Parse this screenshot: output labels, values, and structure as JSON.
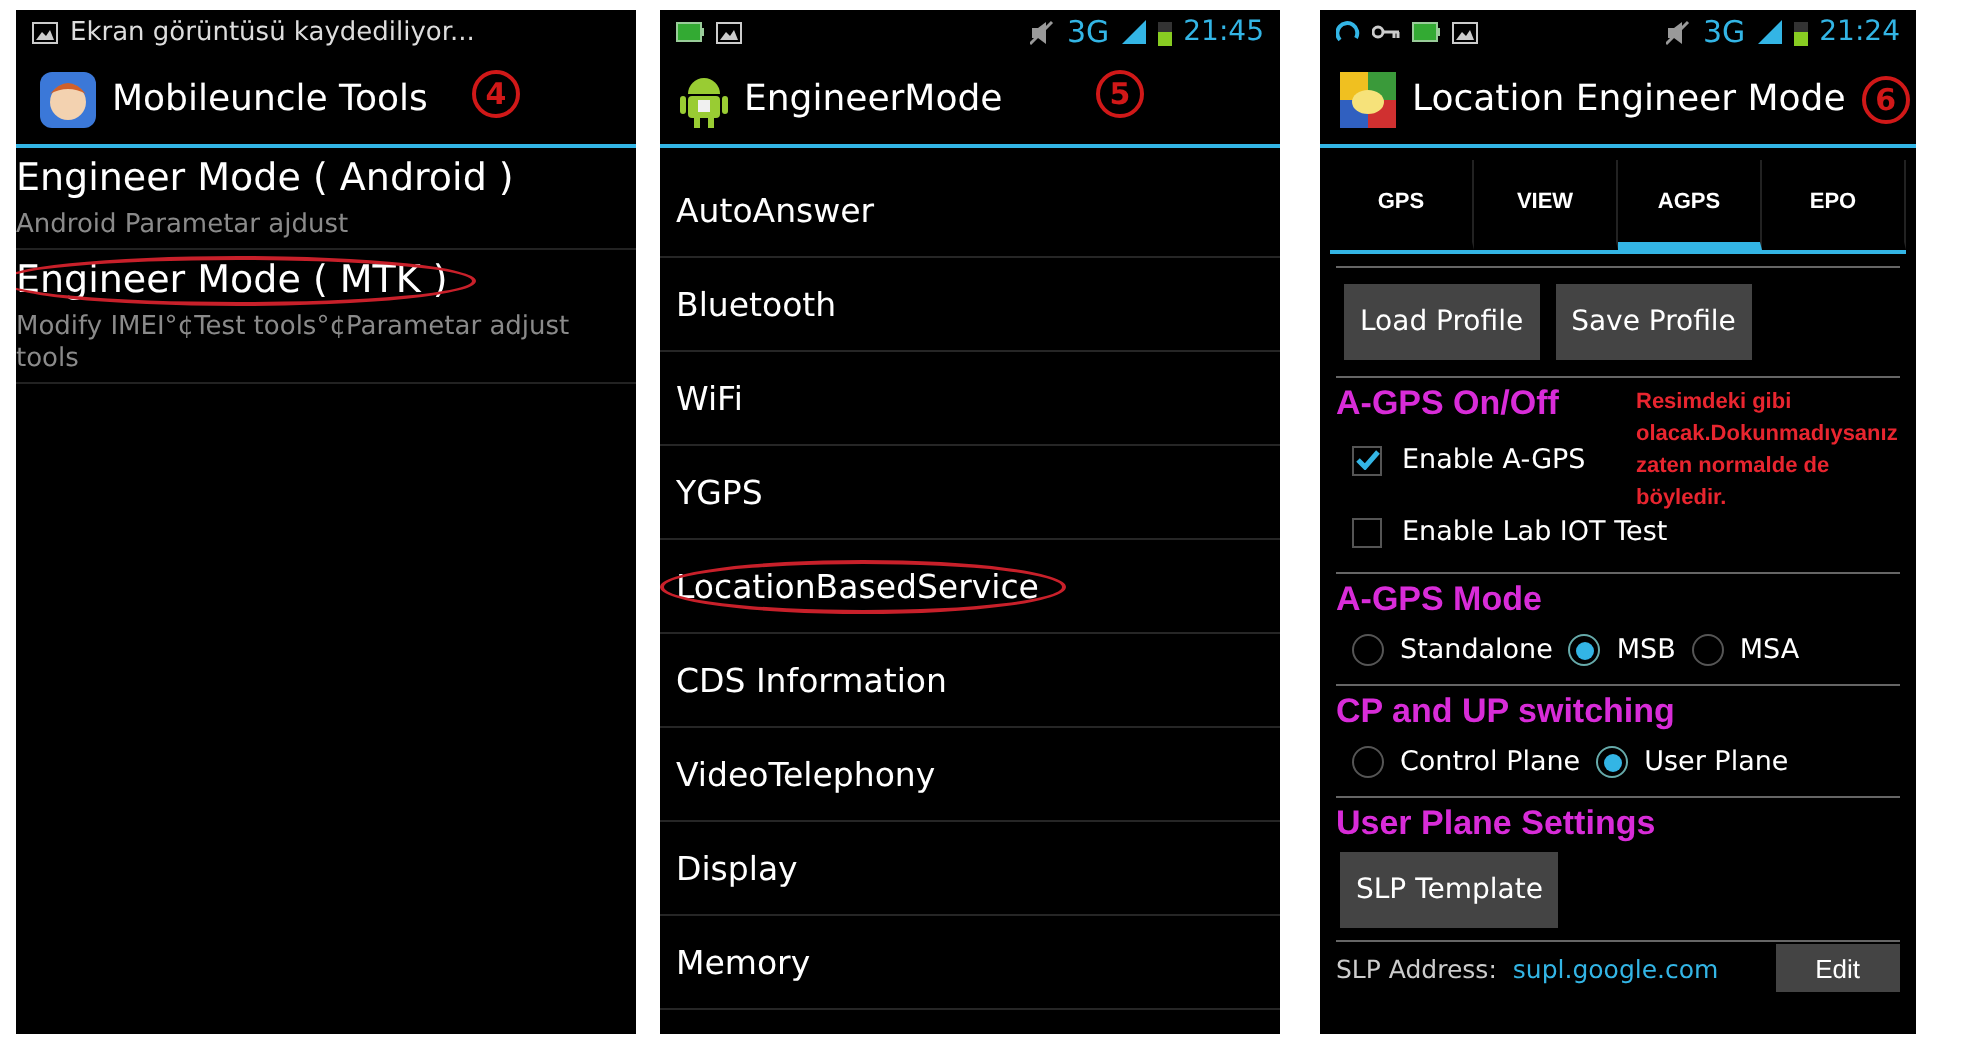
{
  "screens": [
    {
      "kind": "tools",
      "status_bar": {
        "notification": "Ekran görüntüsü kaydediliyor..."
      },
      "title": "Mobileuncle Tools",
      "step": "4",
      "items": [
        {
          "title": "Engineer Mode ( Android )",
          "subtitle": "Android Parametar ajdust",
          "highlighted": false
        },
        {
          "title": "Engineer Mode ( MTK )",
          "subtitle": "Modify IMEI°¢Test tools°¢Parametar adjust tools",
          "highlighted": true
        }
      ]
    },
    {
      "kind": "menu",
      "status_bar": {
        "network": "3G",
        "time": "21:45"
      },
      "title": "EngineerMode",
      "step": "5",
      "items": [
        {
          "title": "AutoAnswer",
          "highlighted": false
        },
        {
          "title": "Bluetooth",
          "highlighted": false
        },
        {
          "title": "WiFi",
          "highlighted": false
        },
        {
          "title": "YGPS",
          "highlighted": false
        },
        {
          "title": "LocationBasedService",
          "highlighted": true
        },
        {
          "title": "CDS Information",
          "highlighted": false
        },
        {
          "title": "VideoTelephony",
          "highlighted": false
        },
        {
          "title": "Display",
          "highlighted": false
        },
        {
          "title": "Memory",
          "highlighted": false
        }
      ]
    },
    {
      "kind": "settings",
      "status_bar": {
        "network": "3G",
        "time": "21:24"
      },
      "title": "Location Engineer Mode",
      "step": "6",
      "tabs": [
        {
          "label": "GPS",
          "selected": false
        },
        {
          "label": "VIEW",
          "selected": false
        },
        {
          "label": "AGPS",
          "selected": true
        },
        {
          "label": "EPO",
          "selected": false
        }
      ],
      "buttons": [
        "Load Profile",
        "Save Profile"
      ],
      "sections": [
        {
          "kind": "checkboxes",
          "heading": "A-GPS On/Off",
          "note": "Resimdeki gibi olacak.Dokunmadıysanız zaten normalde de böyledir.",
          "options": [
            {
              "label": "Enable A-GPS",
              "checked": true
            },
            {
              "label": "Enable Lab IOT Test",
              "checked": false
            }
          ]
        },
        {
          "kind": "radios",
          "heading": "A-GPS Mode",
          "options": [
            {
              "label": "Standalone",
              "selected": false
            },
            {
              "label": "MSB",
              "selected": true
            },
            {
              "label": "MSA",
              "selected": false
            }
          ]
        },
        {
          "kind": "radios",
          "heading": "CP and UP switching",
          "options": [
            {
              "label": "Control Plane",
              "selected": false
            },
            {
              "label": "User Plane",
              "selected": true
            }
          ]
        },
        {
          "kind": "buttons",
          "heading": "User Plane Settings",
          "buttons": [
            "SLP Template"
          ]
        }
      ],
      "slp": {
        "label": "SLP Address:",
        "value": "supl.google.com",
        "button": "Edit"
      }
    }
  ]
}
